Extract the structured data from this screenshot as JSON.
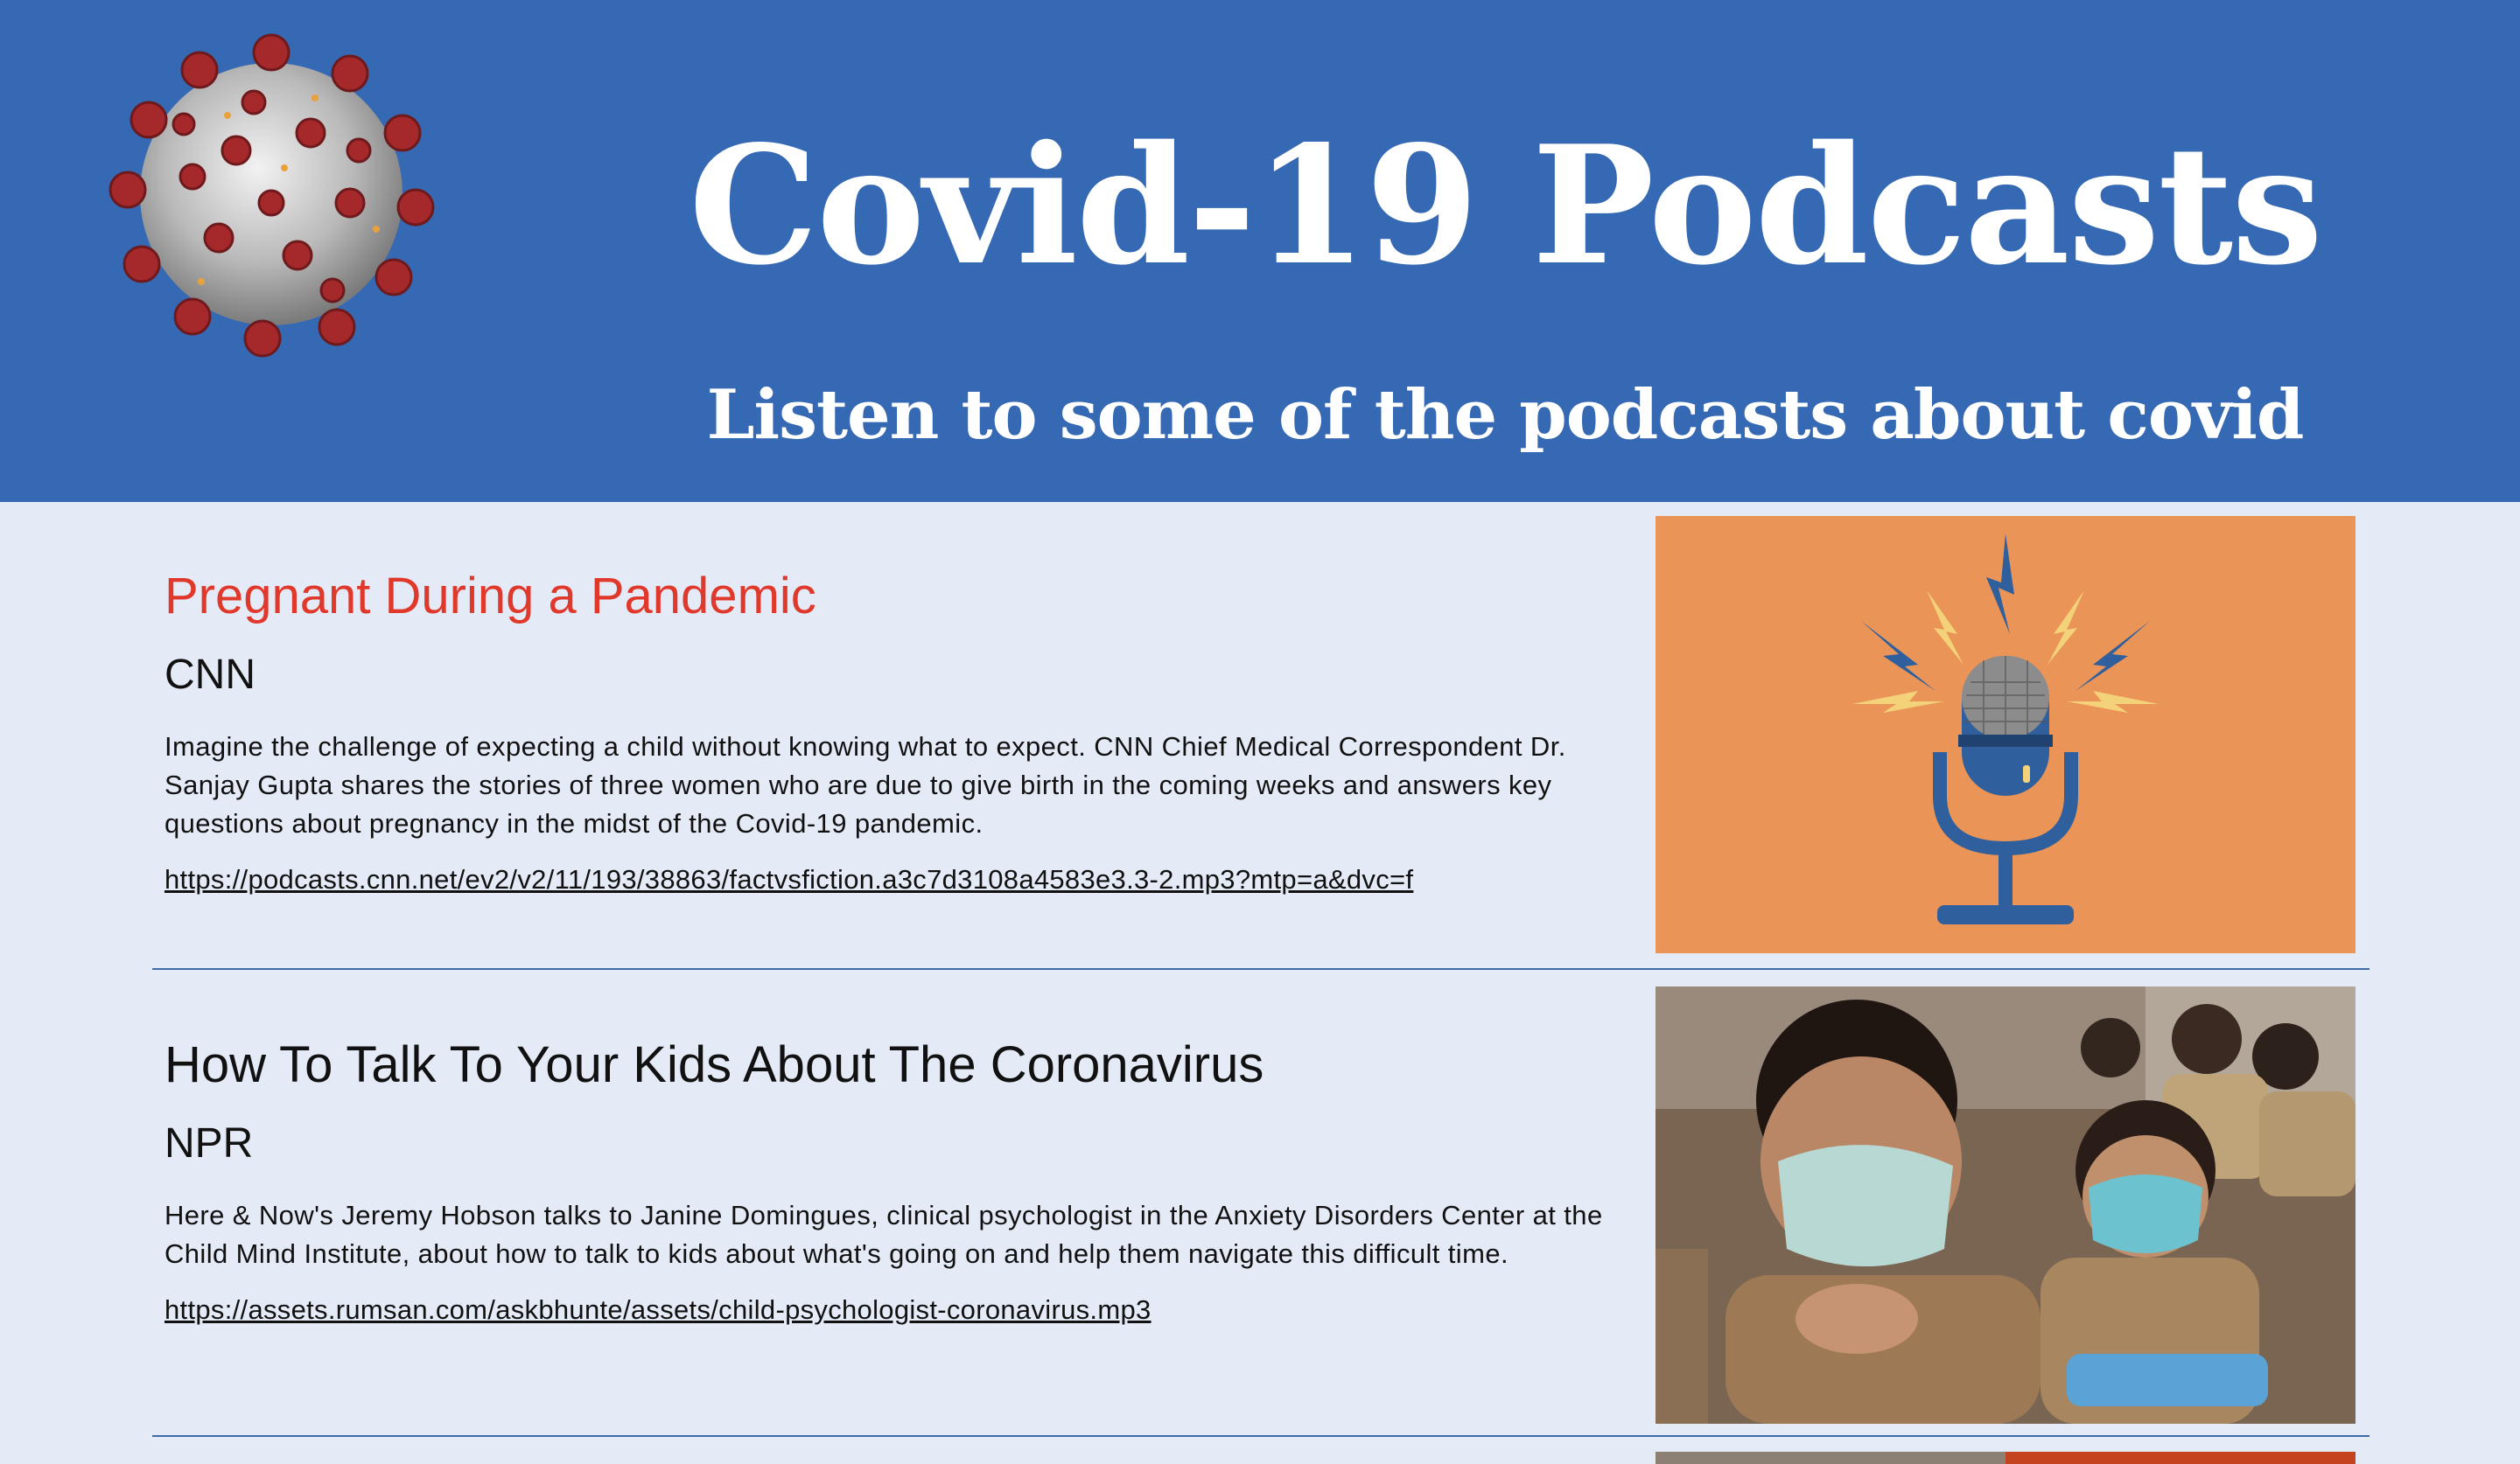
{
  "header": {
    "title": "Covid-19 Podcasts",
    "subtitle": "Listen to some of the podcasts about covid",
    "logo_icon": "coronavirus-icon"
  },
  "podcasts": [
    {
      "title": "Pregnant During a Pandemic",
      "source": "CNN",
      "description": "Imagine the challenge of expecting a child without knowing what to expect. CNN Chief Medical Correspondent Dr. Sanjay Gupta shares the stories of three women who are due to give birth in the coming weeks and answers key questions about pregnancy in the midst of the Covid-19 pandemic.",
      "link": "https://podcasts.cnn.net/ev2/v2/11/193/38863/factvsfiction.a3c7d3108a4583e3.3-2.mp3?mtp=a&dvc=f",
      "image_icon": "microphone-icon",
      "title_color": "#e0382b"
    },
    {
      "title": "How To Talk To Your Kids About The Coronavirus",
      "source": "NPR",
      "description": "Here & Now's Jeremy Hobson talks to Janine Domingues, clinical psychologist in the Anxiety Disorders Center at the Child Mind Institute, about how to talk to kids about what's going on and help them navigate this difficult time.",
      "link": "https://assets.rumsan.com/askbhunte/assets/child-psychologist-coronavirus.mp3",
      "image_icon": "masked-students-photo"
    }
  ],
  "colors": {
    "header_bg": "#3669b3",
    "page_bg": "#e4ebf7",
    "divider": "#3e6aa8",
    "mic_tile_bg": "#ea9557"
  }
}
